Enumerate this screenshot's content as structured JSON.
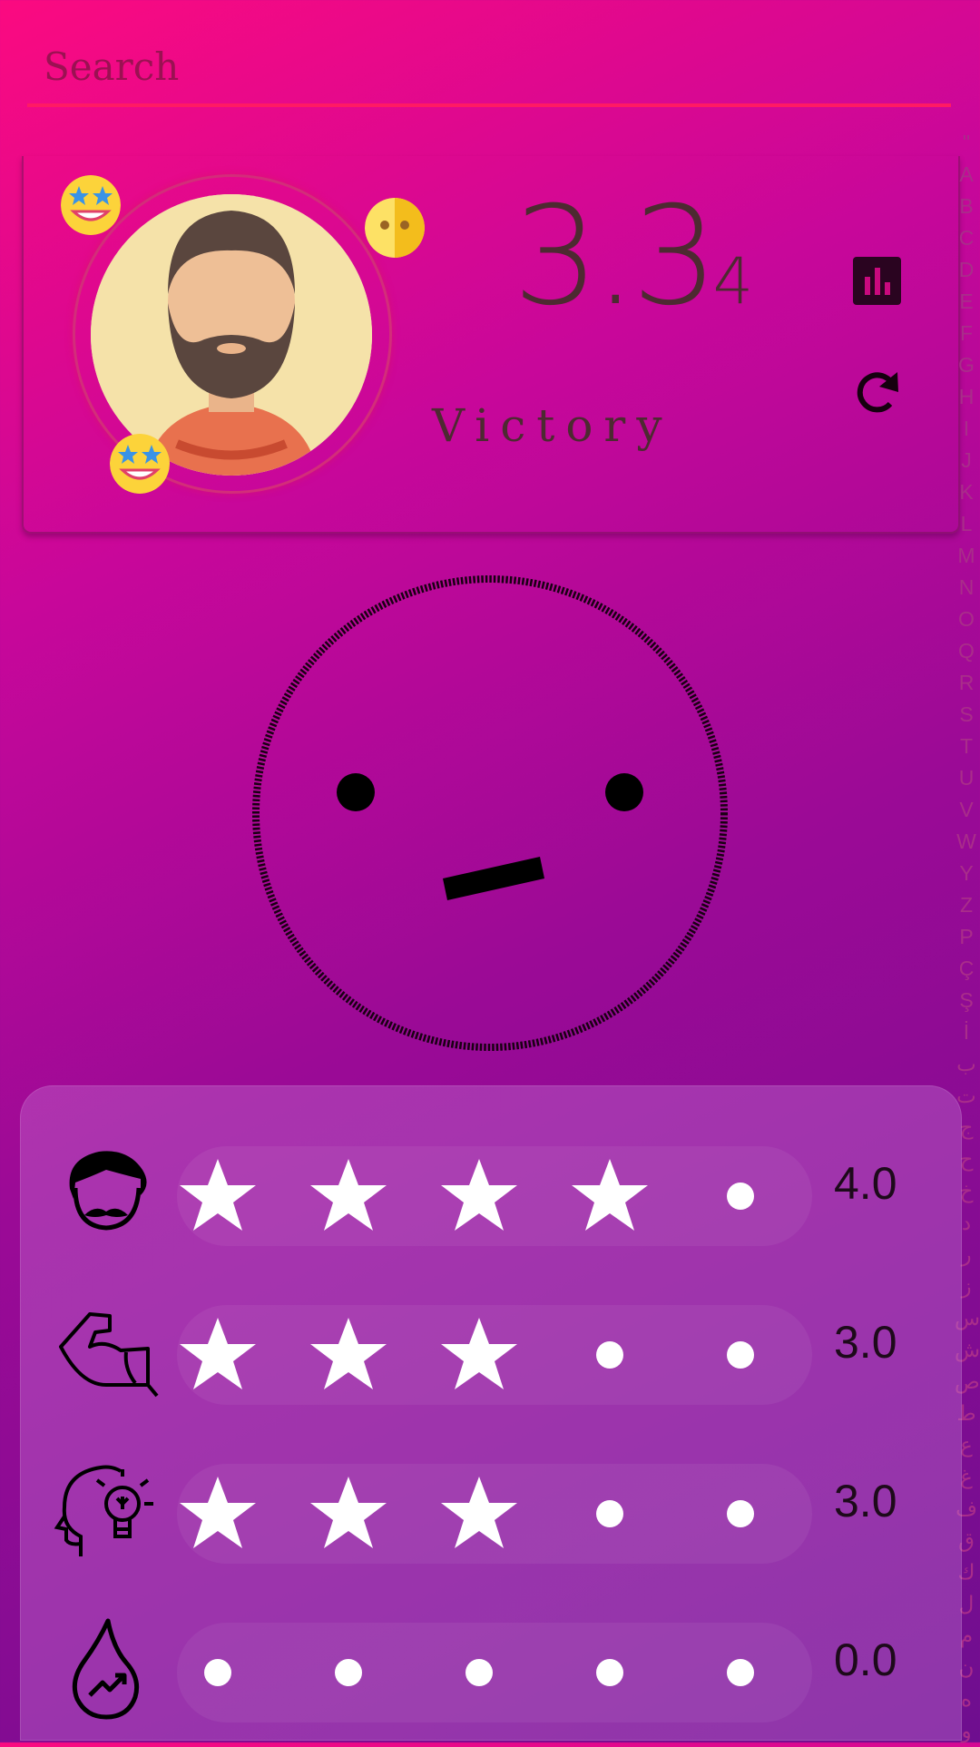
{
  "search": {
    "placeholder": "Search"
  },
  "profile": {
    "score_main": "3.3",
    "score_sub": "4",
    "label": "Victory",
    "stats_icon": "bar-chart-icon",
    "refresh_icon": "refresh-icon"
  },
  "alphabet": [
    "\"",
    "A",
    "B",
    "C",
    "D",
    "E",
    "F",
    "G",
    "H",
    "I",
    "J",
    "K",
    "L",
    "M",
    "N",
    "O",
    "Q",
    "R",
    "S",
    "T",
    "U",
    "V",
    "W",
    "Y",
    "Z",
    "P",
    "Ç",
    "Ş",
    "İ",
    "ب",
    "ت",
    "ج",
    "ح",
    "خ",
    "د",
    "ر",
    "ز",
    "س",
    "ش",
    "ص",
    "ط",
    "ع",
    "غ",
    "ف",
    "ق",
    "ك",
    "ل",
    "م",
    "ن",
    "ه",
    "و"
  ],
  "ratings": [
    {
      "icon": "face-mustache-icon",
      "value": 4,
      "label": "4.0"
    },
    {
      "icon": "muscle-arm-icon",
      "value": 3,
      "label": "3.0"
    },
    {
      "icon": "head-lightbulb-icon",
      "value": 3,
      "label": "3.0"
    },
    {
      "icon": "flame-growth-icon",
      "value": 0,
      "label": "0.0"
    }
  ],
  "colors": {
    "accent": "#ff1a64",
    "text_dark": "#4d2a31"
  }
}
